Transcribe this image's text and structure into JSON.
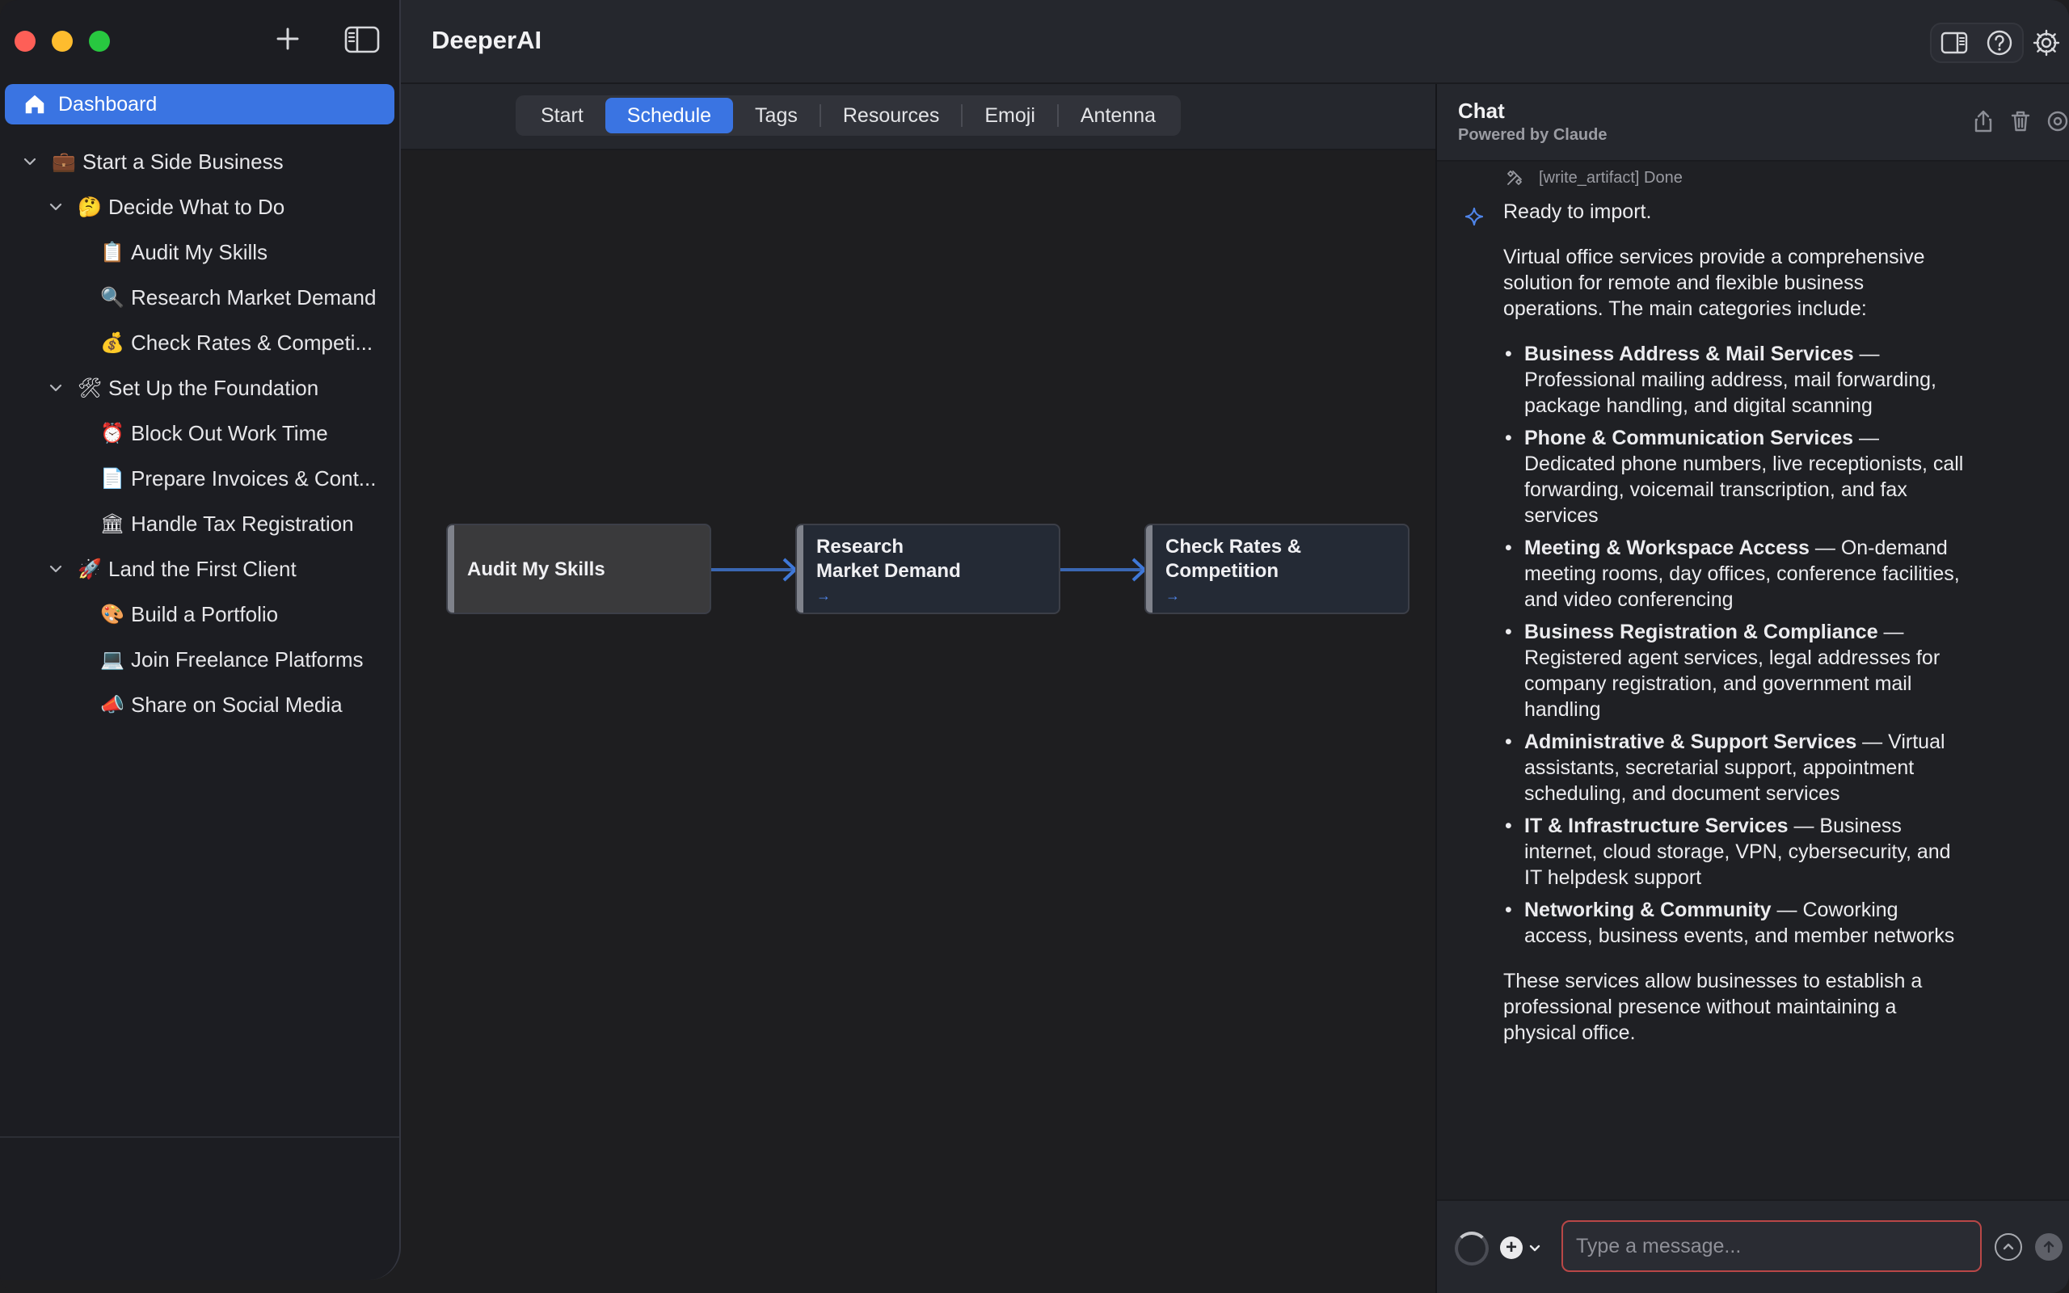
{
  "app": {
    "title": "DeeperAI"
  },
  "sidebar": {
    "dashboard_label": "Dashboard",
    "tree": [
      {
        "level": 0,
        "expanded": true,
        "emoji": "💼",
        "label": "Start a Side Business"
      },
      {
        "level": 1,
        "expanded": true,
        "emoji": "🤔",
        "label": "Decide What to Do"
      },
      {
        "level": 2,
        "emoji": "📋",
        "label": "Audit My Skills"
      },
      {
        "level": 2,
        "emoji": "🔍",
        "label": "Research Market Demand"
      },
      {
        "level": 2,
        "emoji": "💰",
        "label": "Check Rates & Competi..."
      },
      {
        "level": 1,
        "expanded": true,
        "emoji": "🛠",
        "label": "Set Up the Foundation"
      },
      {
        "level": 2,
        "emoji": "⏰",
        "label": "Block Out Work Time"
      },
      {
        "level": 2,
        "emoji": "📄",
        "label": "Prepare Invoices & Cont..."
      },
      {
        "level": 2,
        "emoji": "🏛",
        "label": "Handle Tax Registration"
      },
      {
        "level": 1,
        "expanded": true,
        "emoji": "🚀",
        "label": "Land the First Client"
      },
      {
        "level": 2,
        "emoji": "🎨",
        "label": "Build a Portfolio"
      },
      {
        "level": 2,
        "emoji": "💻",
        "label": "Join Freelance Platforms"
      },
      {
        "level": 2,
        "emoji": "📣",
        "label": "Share on Social Media"
      }
    ]
  },
  "tabs": {
    "items": [
      "Start",
      "Schedule",
      "Tags",
      "Resources",
      "Emoji",
      "Antenna"
    ],
    "active": "Schedule"
  },
  "flow": {
    "nodes": [
      {
        "line1": "Audit My Skills",
        "line2": "",
        "arrow": ""
      },
      {
        "line1": "Research",
        "line2": "Market Demand",
        "arrow": "→"
      },
      {
        "line1": "Check Rates &",
        "line2": "Competition",
        "arrow": "→"
      }
    ]
  },
  "chat": {
    "title": "Chat",
    "subtitle": "Powered by Claude",
    "tool_line": "[write_artifact] Done",
    "ready": "Ready to import.",
    "intro": "Virtual office services provide a comprehensive solution for remote and flexible business operations. The main categories include:",
    "items": [
      {
        "title": "Business Address & Mail Services",
        "desc": " — Professional mailing address, mail forwarding, package handling, and digital scanning"
      },
      {
        "title": "Phone & Communication Services",
        "desc": " — Dedicated phone numbers, live receptionists, call forwarding, voicemail transcription, and fax services"
      },
      {
        "title": "Meeting & Workspace Access",
        "desc": " — On-demand meeting rooms, day offices, conference facilities, and video conferencing"
      },
      {
        "title": "Business Registration & Compliance",
        "desc": " — Registered agent services, legal addresses for company registration, and government mail handling"
      },
      {
        "title": "Administrative & Support Services",
        "desc": " — Virtual assistants, secretarial support, appointment scheduling, and document services"
      },
      {
        "title": "IT & Infrastructure Services",
        "desc": " — Business internet, cloud storage, VPN, cybersecurity, and IT helpdesk support"
      },
      {
        "title": "Networking & Community",
        "desc": " — Coworking access, business events, and member networks"
      }
    ],
    "outro": "These services allow businesses to establish a professional presence without maintaining a physical office.",
    "input_placeholder": "Type a message..."
  },
  "colors": {
    "accent": "#3a74e2",
    "input_border": "#b94747"
  }
}
